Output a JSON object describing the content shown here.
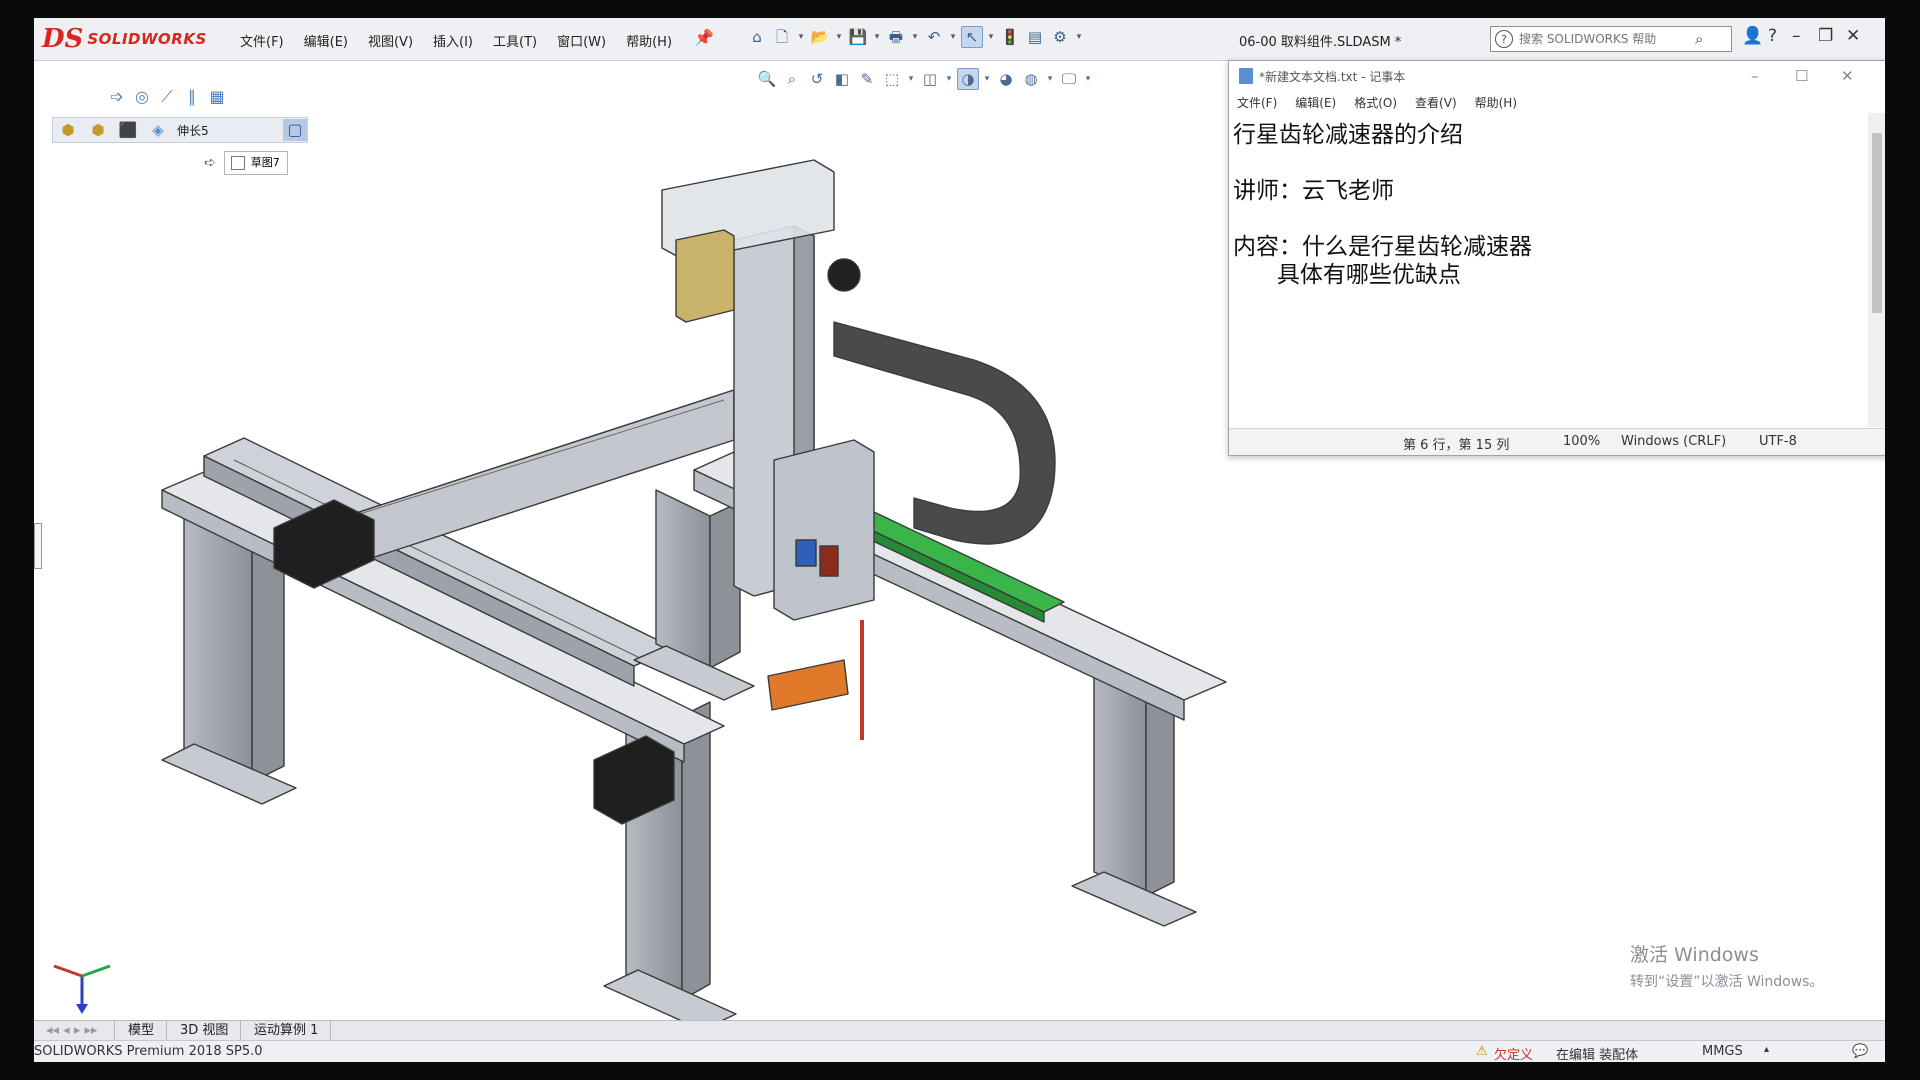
{
  "app": {
    "logo_ds": "DS",
    "logo_text": "SOLIDWORKS",
    "document_title": "06-00 取料组件.SLDASM *"
  },
  "menu": [
    "文件(F)",
    "编辑(E)",
    "视图(V)",
    "插入(I)",
    "工具(T)",
    "窗口(W)",
    "帮助(H)"
  ],
  "search": {
    "placeholder": "搜索 SOLIDWORKS 帮助"
  },
  "feature_flyout": {
    "item_label": "伸长5",
    "sketch_label": "草图7"
  },
  "notepad": {
    "title": "*新建文本文档.txt - 记事本",
    "menu": [
      "文件(F)",
      "编辑(E)",
      "格式(O)",
      "查看(V)",
      "帮助(H)"
    ],
    "lines": [
      "行星齿轮减速器的介绍",
      "",
      "讲师：云飞老师",
      "",
      "内容：什么是行星齿轮减速器",
      "      具体有哪些优缺点"
    ],
    "status": {
      "position": "第 6 行，第 15 列",
      "zoom": "100%",
      "line_ending": "Windows (CRLF)",
      "encoding": "UTF-8"
    }
  },
  "bottom_tabs": [
    "模型",
    "3D 视图",
    "运动算例 1"
  ],
  "statusbar": {
    "version": "SOLIDWORKS Premium 2018 SP5.0",
    "warning": "欠定义",
    "mode": "在编辑 装配体",
    "units": "MMGS"
  },
  "watermark": {
    "line1": "激活 Windows",
    "line2": "转到“设置”以激活 Windows。"
  },
  "colors": {
    "brand_red": "#d9261c",
    "frame_gray": "#c9ccd3",
    "green_rail": "#3ab54a",
    "cable_carrier": "#4a4a4a"
  }
}
